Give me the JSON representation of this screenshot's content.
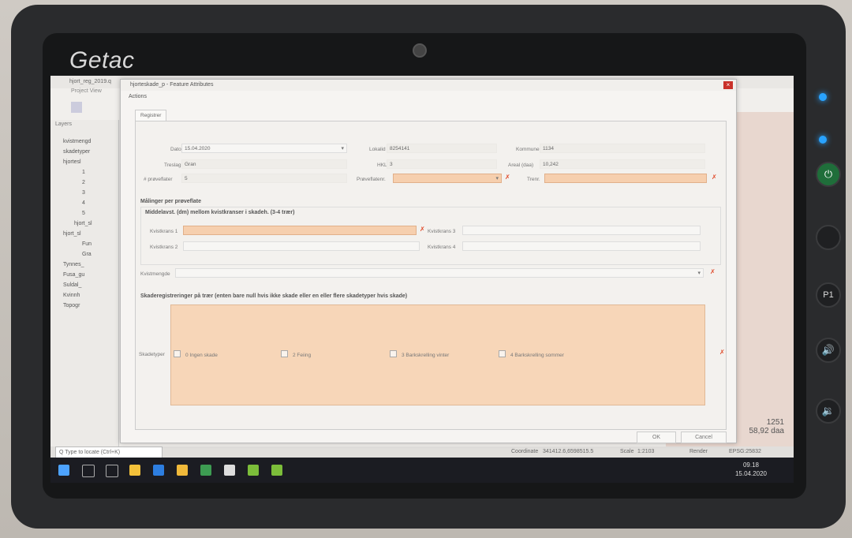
{
  "device": {
    "brand": "Getac",
    "hardware_buttons": [
      "P1"
    ]
  },
  "qgis": {
    "title": "hjort_reg_2019.q",
    "menu": "Project  View",
    "layers_title": "Layers",
    "layers": [
      "kvistmengd",
      "skadetyper",
      "hjortesl",
      "1",
      "2",
      "3",
      "4",
      "5",
      "hjort_sl",
      "hjort_sl",
      "Fun",
      "Gra",
      "Tynnes_",
      "Fusa_gu",
      "Suldal_",
      "Kvinnh",
      "Topogr"
    ],
    "map_labels": [
      "1251",
      "58,92 daa"
    ],
    "status": {
      "locate_placeholder": "Q  Type to locate (Ctrl+K)",
      "coordinate_label": "Coordinate",
      "coordinate_value": "341412.6,6598515.5",
      "scale_label": "Scale",
      "scale_value": "1:2103",
      "render": "Render",
      "epsg": "EPSG:25832"
    },
    "clock": {
      "time": "09.18",
      "date": "15.04.2020"
    }
  },
  "dialog": {
    "title": "hjorteskade_p - Feature Attributes",
    "actions": "Actions",
    "tab": "Registrer",
    "fields": {
      "dato_label": "Dato",
      "dato_value": "15.04.2020",
      "lokalid_label": "Lokalid",
      "lokalid_value": "8254141",
      "kommune_label": "Kommune",
      "kommune_value": "1134",
      "treslag_label": "Treslag",
      "treslag_value": "Gran",
      "hkl_label": "HKL",
      "hkl_value": "3",
      "areal_label": "Areal (daa)",
      "areal_value": "10,242",
      "proveflater_label": "# prøveflater",
      "proveflater_value": "5",
      "proveflatenr_label": "Prøveflatenr.",
      "trenr_label": "Trenr."
    },
    "section_maalinger": "Målinger per prøveflate",
    "group_middelavst": "Middelavst. (dm) mellom kvistkranser i skadeh. (3-4 trær)",
    "kvistkrans_1": "Kvistkrans 1",
    "kvistkrans_2": "Kvistkrans 2",
    "kvistkrans_3": "Kvistkrans 3",
    "kvistkrans_4": "Kvistkrans 4",
    "kvistmengde": "Kvistmengde",
    "section_skade": "Skaderegistreringer på trær (enten bare null hvis ikke skade eller en eller flere skadetyper hvis skade)",
    "skadetyper_label": "Skadetyper",
    "skadetyper": [
      "0 Ingen skade",
      "2 Feiing",
      "3 Barkskrelling vinter",
      "4 Barkskrelling sommer"
    ],
    "ok": "OK",
    "cancel": "Cancel",
    "close_glyph": "×",
    "required_marker": "✗"
  }
}
